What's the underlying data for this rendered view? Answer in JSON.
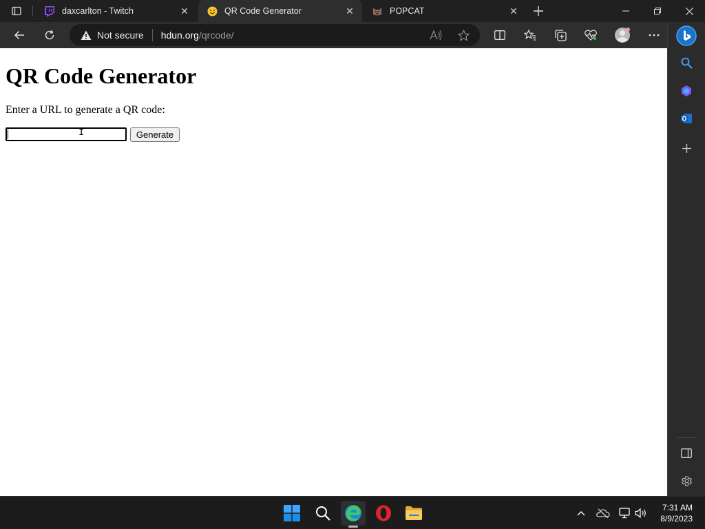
{
  "tabs": [
    {
      "title": "daxcarlton - Twitch",
      "favicon": "twitch-icon",
      "active": false
    },
    {
      "title": "QR Code Generator",
      "favicon": "smiley-face-icon",
      "active": true
    },
    {
      "title": "POPCAT",
      "favicon": "popcat-icon",
      "active": false
    }
  ],
  "address_bar": {
    "security_label": "Not secure",
    "host": "hdun.org",
    "path": "/qrcode/"
  },
  "page": {
    "heading": "QR Code Generator",
    "prompt": "Enter a URL to generate a QR code:",
    "url_input_value": "",
    "generate_label": "Generate"
  },
  "taskbar": {
    "time": "7:31 AM",
    "date": "8/9/2023"
  },
  "colors": {
    "accent": "#0078d4",
    "twitch": "#9146ff",
    "opera": "#e0242d",
    "folder": "#f2c14e"
  }
}
